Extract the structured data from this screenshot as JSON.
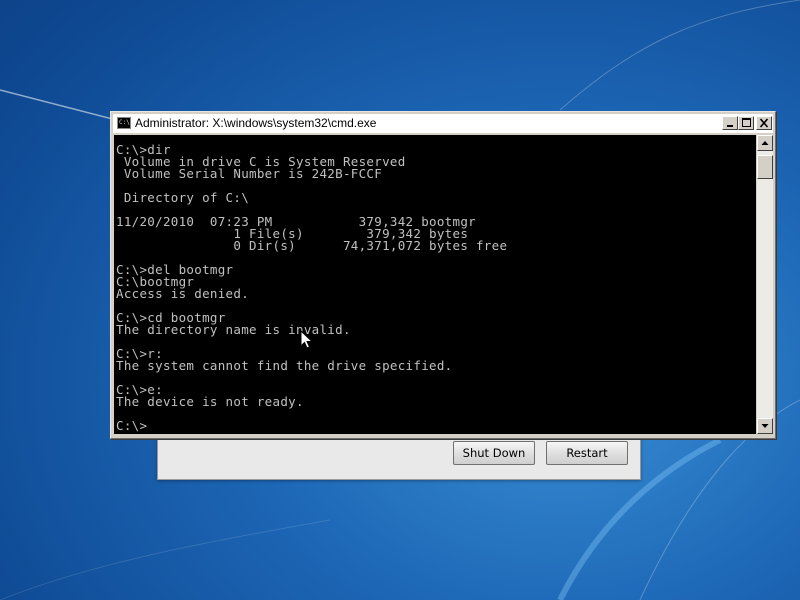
{
  "window": {
    "title": "Administrator: X:\\windows\\system32\\cmd.exe",
    "icon_text": "C:\\"
  },
  "console": {
    "lines": [
      "C:\\>dir",
      " Volume in drive C is System Reserved",
      " Volume Serial Number is 242B-FCCF",
      "",
      " Directory of C:\\",
      "",
      "11/20/2010  07:23 PM           379,342 bootmgr",
      "               1 File(s)        379,342 bytes",
      "               0 Dir(s)      74,371,072 bytes free",
      "",
      "C:\\>del bootmgr",
      "C:\\bootmgr",
      "Access is denied.",
      "",
      "C:\\>cd bootmgr",
      "The directory name is invalid.",
      "",
      "C:\\>r:",
      "The system cannot find the drive specified.",
      "",
      "C:\\>e:",
      "The device is not ready.",
      "",
      "C:\\>"
    ]
  },
  "recovery_dialog": {
    "shutdown_label": "Shut Down",
    "restart_label": "Restart"
  },
  "colors": {
    "console_background": "#000000",
    "console_text": "#c0c0c0",
    "desktop_accent": "#1d67b6"
  },
  "icons": {
    "window_icon": "cmd-icon",
    "cursor": "mouse-pointer-icon"
  }
}
